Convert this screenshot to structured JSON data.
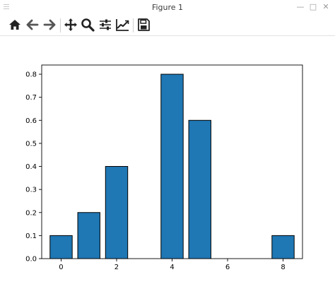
{
  "window": {
    "title": "Figure 1",
    "minimize_glyph": "—",
    "maximize_glyph": "□",
    "close_glyph": "✕"
  },
  "toolbar": {
    "buttons": [
      {
        "name": "home-icon",
        "label": "Home"
      },
      {
        "name": "back-arrow-icon",
        "label": "Back"
      },
      {
        "name": "forward-arrow-icon",
        "label": "Forward"
      },
      {
        "name": "pan-move-icon",
        "label": "Pan"
      },
      {
        "name": "zoom-magnifier-icon",
        "label": "Zoom"
      },
      {
        "name": "subplots-sliders-icon",
        "label": "Configure subplots"
      },
      {
        "name": "edit-axes-icon",
        "label": "Edit axis"
      },
      {
        "name": "save-disk-icon",
        "label": "Save"
      }
    ]
  },
  "colors": {
    "bar_fill": "#1f77b4",
    "bar_edge": "#000000",
    "icon": "#222222",
    "arrow_icon": "#555555"
  },
  "chart_data": {
    "type": "bar",
    "x": [
      0,
      1,
      2,
      4,
      5,
      8
    ],
    "values": [
      0.1,
      0.2,
      0.4,
      0.8,
      0.6,
      0.1
    ],
    "bar_width": 0.8,
    "xlim": [
      -0.7,
      8.7
    ],
    "ylim": [
      0,
      0.84
    ],
    "xticks": [
      0,
      2,
      4,
      6,
      8
    ],
    "yticks": [
      0.0,
      0.1,
      0.2,
      0.3,
      0.4,
      0.5,
      0.6,
      0.7,
      0.8
    ],
    "xtick_labels": [
      "0",
      "2",
      "4",
      "6",
      "8"
    ],
    "ytick_labels": [
      "0.0",
      "0.1",
      "0.2",
      "0.3",
      "0.4",
      "0.5",
      "0.6",
      "0.7",
      "0.8"
    ],
    "title": "",
    "xlabel": "",
    "ylabel": "",
    "grid": false,
    "legend": false
  }
}
